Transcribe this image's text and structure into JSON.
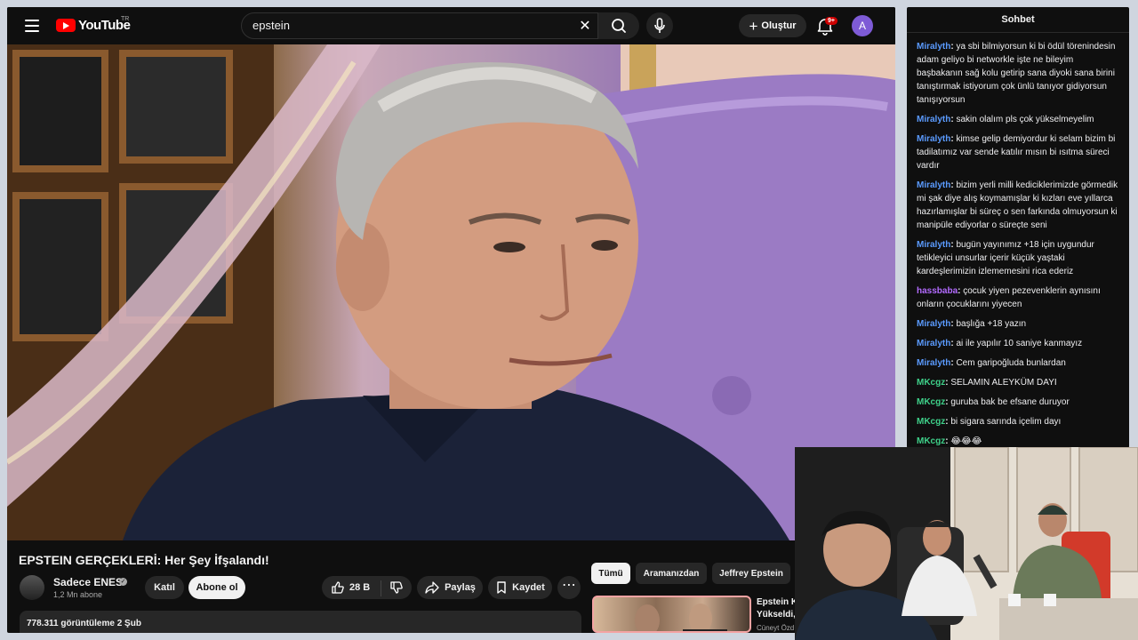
{
  "topbar": {
    "logo_text": "YouTube",
    "country_code": "TR",
    "search_value": "epstein",
    "search_placeholder": "Ara",
    "create_label": "Oluştur",
    "notification_badge": "9+",
    "avatar_letter": "A"
  },
  "video": {
    "title": "EPSTEIN GERÇEKLERİ: Her Şey İfşalandı!",
    "channel_name": "Sadece ENES",
    "subscribers": "1,2 Mn abone",
    "join_label": "Katıl",
    "subscribe_label": "Abone ol",
    "likes": "28 B",
    "share_label": "Paylaş",
    "save_label": "Kaydet",
    "views_and_date": "778.311 görüntüleme  2 Şub"
  },
  "chips": [
    "Tümü",
    "Aramanızdan",
    "Jeffrey Epstein"
  ],
  "recommendation": {
    "title_line1": "Epstein K",
    "title_line2": "Yükseldi,",
    "channel": "Cüneyt Özd"
  },
  "chat": {
    "header": "Sohbet",
    "messages": [
      {
        "user": "Miralyth",
        "color": "#5b9bff",
        "text": "ya sbi bilmiyorsun ki bi ödül törenindesin adam geliyo bi networkle işte ne bileyim başbakanın sağ kolu getirip sana diyoki sana birini tanıştırmak istiyorum çok ünlü tanıyor gidiyorsun tanışıyorsun"
      },
      {
        "user": "Miralyth",
        "color": "#5b9bff",
        "text": "sakin olalım pls çok yükselmeyelim"
      },
      {
        "user": "Miralyth",
        "color": "#5b9bff",
        "text": "kimse gelip demiyordur ki selam bizim bi tadilatımız var sende katılır mısın bi ısıtma süreci vardır"
      },
      {
        "user": "Miralyth",
        "color": "#5b9bff",
        "text": "bizim yerli milli kediciklerimizde görmedik mi şak diye alış koymamışlar ki kızları eve yıllarca hazırlamışlar bi süreç o sen farkında olmuyorsun ki manipüle ediyorlar o süreçte seni"
      },
      {
        "user": "Miralyth",
        "color": "#5b9bff",
        "text": "bugün yayınımız +18 için uygundur tetikleyici unsurlar içerir küçük yaştaki kardeşlerimizin izlememesini rica ederiz"
      },
      {
        "user": "hassbaba",
        "color": "#b36bff",
        "text": "çocuk yiyen pezevenklerin aynısını onların çocuklarını yiyecen"
      },
      {
        "user": "Miralyth",
        "color": "#5b9bff",
        "text": "başlığa +18 yazın"
      },
      {
        "user": "Miralyth",
        "color": "#5b9bff",
        "text": "ai ile yapılır 10 saniye kanmayız"
      },
      {
        "user": "Miralyth",
        "color": "#5b9bff",
        "text": "Cem garipoğluda bunlardan"
      },
      {
        "user": "MKcgz",
        "color": "#3fd18a",
        "text": "SELAMIN ALEYKÜM DAYI"
      },
      {
        "user": "MKcgz",
        "color": "#3fd18a",
        "text": "guruba bak be efsane duruyor"
      },
      {
        "user": "MKcgz",
        "color": "#3fd18a",
        "text": "bi sigara sarında içelim dayı"
      },
      {
        "user": "MKcgz",
        "color": "#3fd18a",
        "text": "😂😂😂"
      }
    ]
  }
}
